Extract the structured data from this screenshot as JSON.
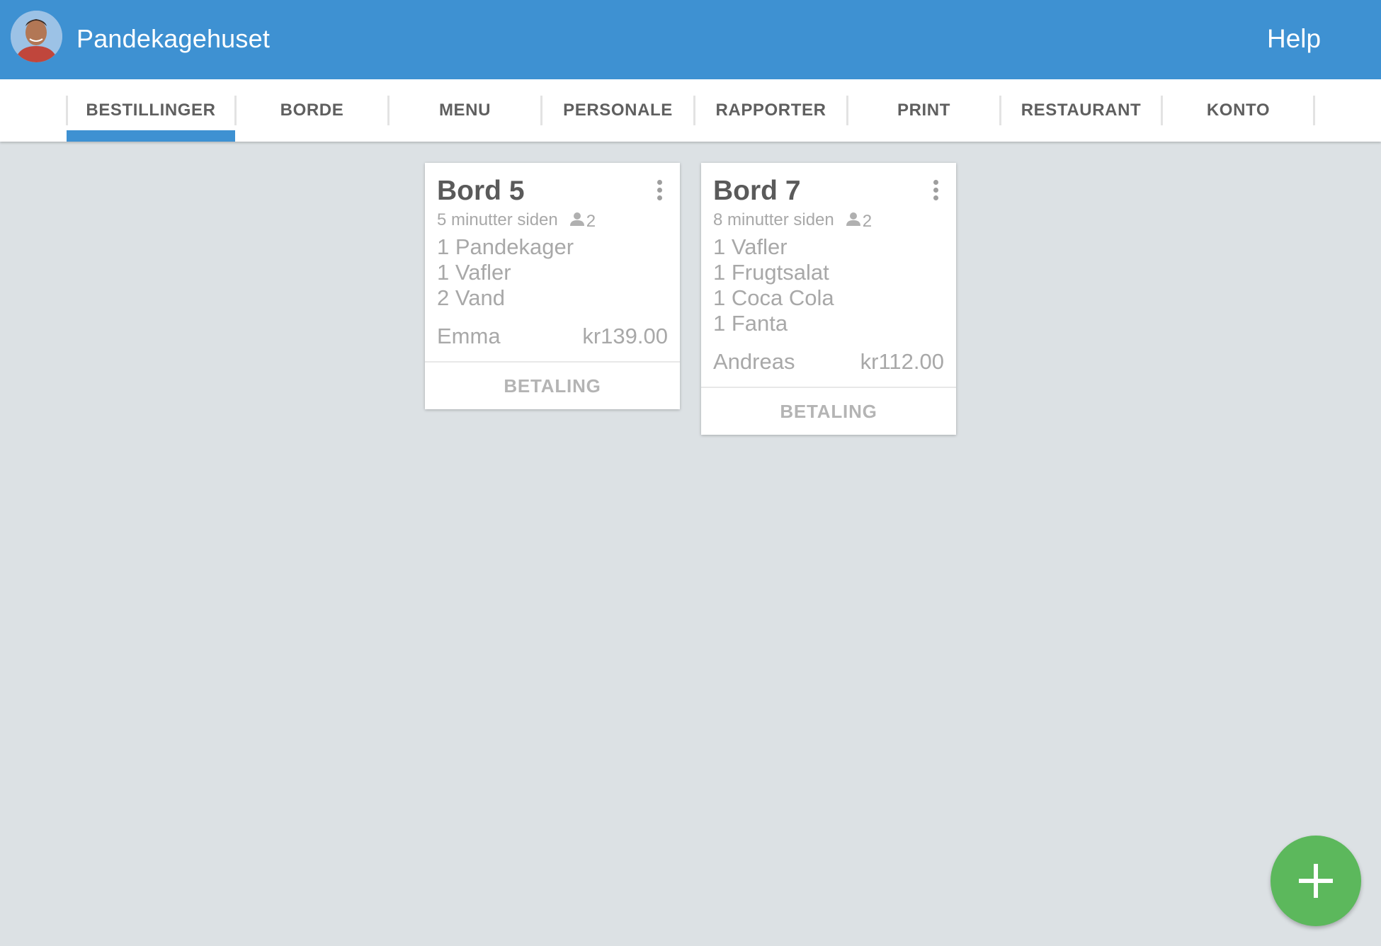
{
  "header": {
    "title": "Pandekagehuset",
    "help_label": "Help",
    "bar_color": "#3e91d2"
  },
  "tabs": [
    {
      "label": "BESTILLINGER",
      "active": true
    },
    {
      "label": "BORDE",
      "active": false
    },
    {
      "label": "MENU",
      "active": false
    },
    {
      "label": "PERSONALE",
      "active": false
    },
    {
      "label": "RAPPORTER",
      "active": false
    },
    {
      "label": "PRINT",
      "active": false
    },
    {
      "label": "RESTAURANT",
      "active": false
    },
    {
      "label": "KONTO",
      "active": false
    }
  ],
  "orders": [
    {
      "table": "Bord 5",
      "time_ago": "5 minutter siden",
      "guests": "2",
      "items": [
        "1 Pandekager",
        "1 Vafler",
        "2 Vand"
      ],
      "waiter": "Emma",
      "total": "kr139.00",
      "action_label": "BETALING"
    },
    {
      "table": "Bord 7",
      "time_ago": "8 minutter siden",
      "guests": "2",
      "items": [
        "1 Vafler",
        "1 Frugtsalat",
        "1 Coca Cola",
        "1 Fanta"
      ],
      "waiter": "Andreas",
      "total": "kr112.00",
      "action_label": "BETALING"
    }
  ],
  "fab": {
    "icon": "plus-icon",
    "color": "#5cb85c"
  }
}
